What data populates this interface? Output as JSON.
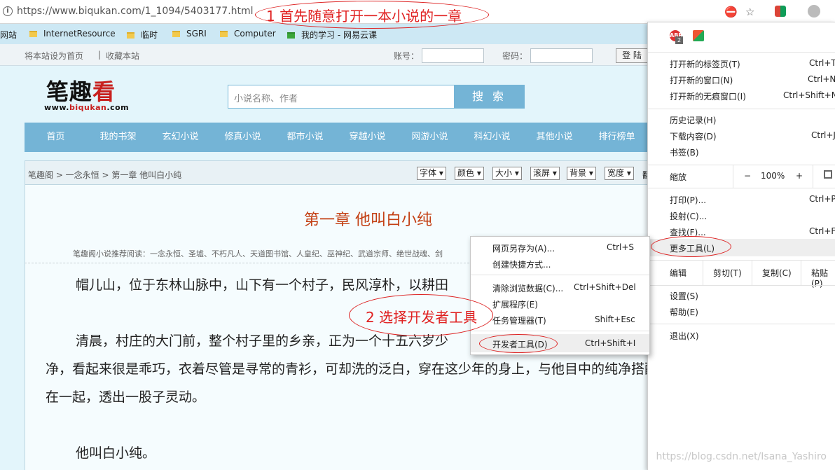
{
  "browser": {
    "url": "https://www.biqukan.com/1_1094/5403177.html",
    "bookmarks": [
      {
        "label": "网站",
        "icon": "none"
      },
      {
        "label": "InternetResource",
        "icon": "folder-icon"
      },
      {
        "label": "临时",
        "icon": "folder-icon"
      },
      {
        "label": "SGRI",
        "icon": "folder-icon"
      },
      {
        "label": "Computer",
        "icon": "folder-icon"
      },
      {
        "label": "我的学习 - 网易云课",
        "icon": "course-icon"
      }
    ],
    "extension_badge": "2",
    "colors": {
      "bookmark_bar": "#cde8f4",
      "menu_bg": "#ffffff"
    }
  },
  "site": {
    "topbar": {
      "set_home": "将本站设为首页",
      "separator": "|",
      "favorite": "收藏本站",
      "account_label": "账号：",
      "password_label": "密码：",
      "login_button": "登 陆"
    },
    "logo": {
      "text_part1": "笔",
      "text_part2": "趣",
      "text_part3": "看",
      "url_part1": "www.",
      "url_part2": "biqukan",
      "url_part3": ".com"
    },
    "search": {
      "placeholder": "小说名称、作者",
      "button": "搜 索"
    },
    "nav": [
      "首页",
      "我的书架",
      "玄幻小说",
      "修真小说",
      "都市小说",
      "穿越小说",
      "网游小说",
      "科幻小说",
      "其他小说",
      "排行榜单"
    ],
    "breadcrumb": "笔趣阁 > 一念永恒 > 第一章 他叫白小纯",
    "reader_options": [
      "字体",
      "颜色",
      "大小",
      "滚屏",
      "背景",
      "宽度",
      "翻"
    ],
    "chapter_title": "第一章 他叫白小纯",
    "recommend": "笔趣阁小说推荐阅读：一念永恒、圣墟、不朽凡人、天道图书馆、人皇纪、巫神纪、武道宗师、绝世战魂、剑",
    "paragraphs": [
      "帽儿山，位于东林山脉中，山下有一个村子，民风淳朴，以耕田",
      "清晨，村庄的大门前，整个村子里的乡亲，正为一个十五六岁少",
      "净，看起来很是乖巧，衣着尽管是寻常的青衫，可却洗的泛白，穿在这少年的身上，与他目中的纯净搭配",
      "在一起，透出一股子灵动。",
      "他叫白小纯。"
    ],
    "colors": {
      "nav": "#74b4d6",
      "chapter_title": "#c33f13",
      "page_bg": "#e3f5fb"
    }
  },
  "chrome_menu": {
    "new_tab": {
      "label": "打开新的标签页(T)",
      "shortcut": "Ctrl+T"
    },
    "new_window": {
      "label": "打开新的窗口(N)",
      "shortcut": "Ctrl+N"
    },
    "new_incognito": {
      "label": "打开新的无痕窗口(I)",
      "shortcut": "Ctrl+Shift+N"
    },
    "history": {
      "label": "历史记录(H)"
    },
    "downloads": {
      "label": "下载内容(D)",
      "shortcut": "Ctrl+J"
    },
    "bookmarks": {
      "label": "书签(B)"
    },
    "zoom": {
      "label": "缩放",
      "minus": "−",
      "value": "100%",
      "plus": "+"
    },
    "print": {
      "label": "打印(P)...",
      "shortcut": "Ctrl+P"
    },
    "cast": {
      "label": "投射(C)..."
    },
    "find": {
      "label": "查找(F)...",
      "shortcut": "Ctrl+F"
    },
    "more_tools": {
      "label": "更多工具(L)"
    },
    "edit": {
      "label": "编辑",
      "cut": "剪切(T)",
      "copy": "复制(C)",
      "paste": "粘贴(P)"
    },
    "settings": {
      "label": "设置(S)"
    },
    "help": {
      "label": "帮助(E)"
    },
    "exit": {
      "label": "退出(X)"
    }
  },
  "submenu": {
    "save_page": {
      "label": "网页另存为(A)...",
      "shortcut": "Ctrl+S"
    },
    "create_shortcut": {
      "label": "创建快捷方式..."
    },
    "clear_data": {
      "label": "清除浏览数据(C)...",
      "shortcut": "Ctrl+Shift+Del"
    },
    "extensions": {
      "label": "扩展程序(E)"
    },
    "task_manager": {
      "label": "任务管理器(T)",
      "shortcut": "Shift+Esc"
    },
    "dev_tools": {
      "label": "开发者工具(D)",
      "shortcut": "Ctrl+Shift+I"
    }
  },
  "annotations": {
    "step1": "1 首先随意打开一本小说的一章",
    "step2": "2 选择开发者工具",
    "color": "#e02020"
  },
  "watermark": "https://blog.csdn.net/Isana_Yashiro"
}
